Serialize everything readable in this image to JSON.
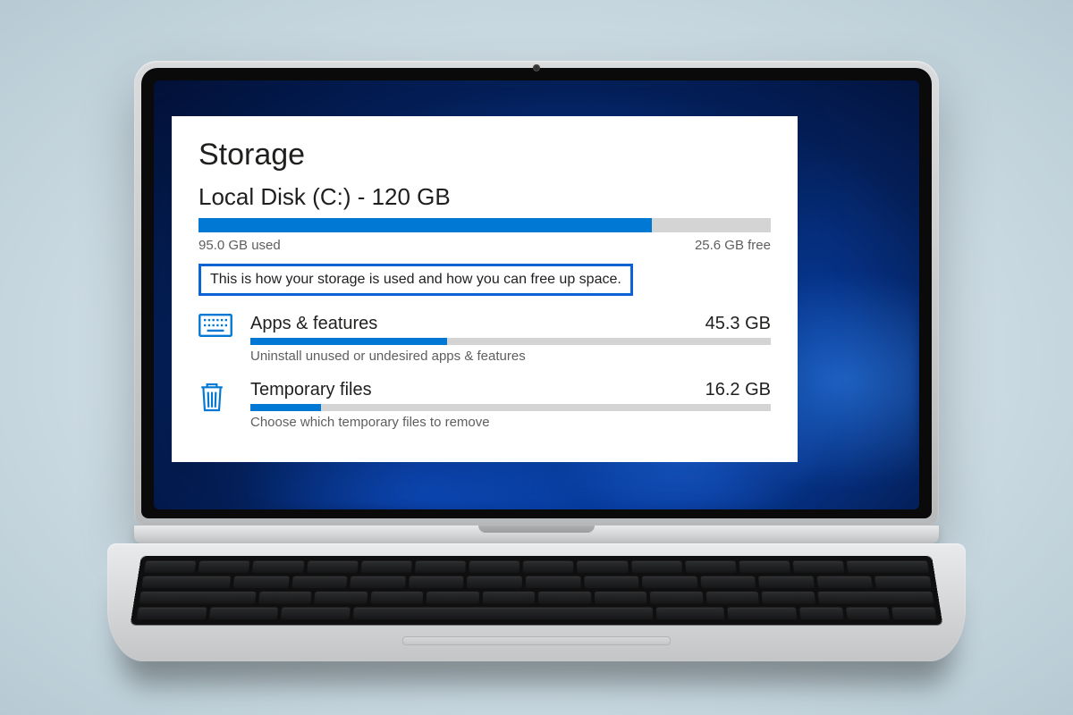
{
  "storage": {
    "title": "Storage",
    "disk_label": "Local Disk (C:) - 120 GB",
    "total_gb": 120,
    "used_label": "95.0 GB used",
    "used_gb": 95.0,
    "free_label": "25.6 GB free",
    "free_gb": 25.6,
    "description": "This is how your storage is used and how you can free up space."
  },
  "categories": [
    {
      "icon": "keyboard-icon",
      "name": "Apps & features",
      "size_label": "45.3 GB",
      "size_gb": 45.3,
      "hint": "Uninstall unused or undesired apps & features"
    },
    {
      "icon": "trash-icon",
      "name": "Temporary files",
      "size_label": "16.2 GB",
      "size_gb": 16.2,
      "hint": "Choose which temporary files to remove"
    }
  ],
  "colors": {
    "accent": "#0078d4",
    "highlight_border": "#0b63d6",
    "bar_bg": "#d4d4d4",
    "text_primary": "#201f1e",
    "text_secondary": "#605e5c"
  }
}
